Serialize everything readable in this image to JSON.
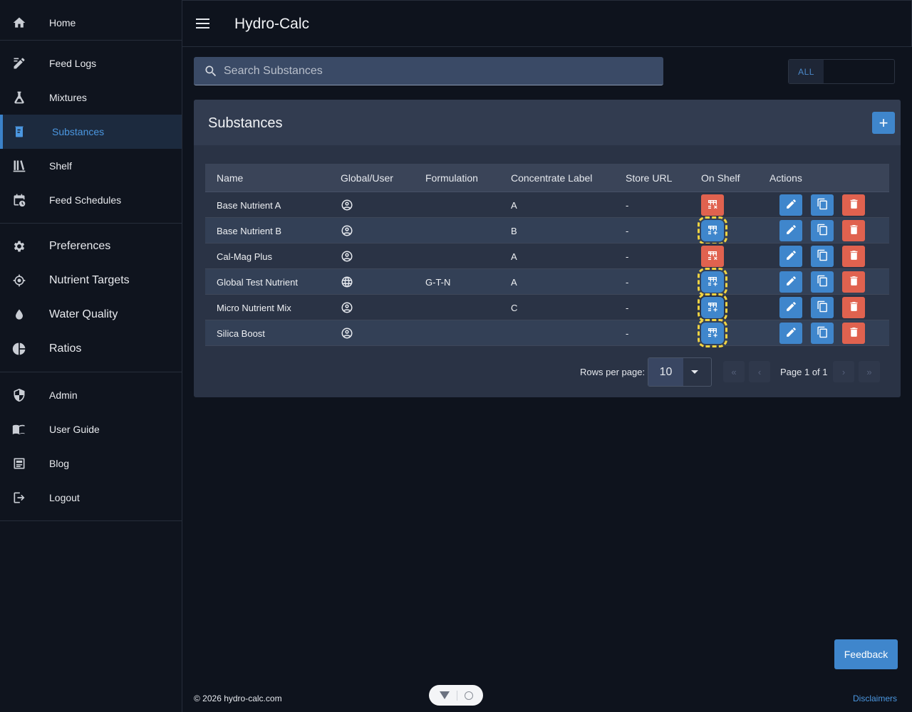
{
  "app": {
    "title": "Hydro-Calc"
  },
  "sidebar": {
    "groups": [
      [
        {
          "label": "Home",
          "icon": "home-icon"
        }
      ],
      [
        {
          "label": "Feed Logs",
          "icon": "feed-logs-icon"
        },
        {
          "label": "Mixtures",
          "icon": "flask-icon"
        },
        {
          "label": "Substances",
          "icon": "substance-icon",
          "active": true
        },
        {
          "label": "Shelf",
          "icon": "shelf-icon"
        },
        {
          "label": "Feed Schedules",
          "icon": "calendar-clock-icon"
        }
      ],
      [
        {
          "label": "Preferences",
          "icon": "gear-icon"
        },
        {
          "label": "Nutrient Targets",
          "icon": "crosshair-icon"
        },
        {
          "label": "Water Quality",
          "icon": "water-drop-icon"
        },
        {
          "label": "Ratios",
          "icon": "pie-chart-icon"
        }
      ],
      [
        {
          "label": "Admin",
          "icon": "shield-icon"
        },
        {
          "label": "User Guide",
          "icon": "book-icon"
        },
        {
          "label": "Blog",
          "icon": "newspaper-icon"
        },
        {
          "label": "Logout",
          "icon": "logout-icon"
        }
      ]
    ]
  },
  "search": {
    "placeholder": "Search Substances",
    "value": ""
  },
  "filter": {
    "all_label": "ALL"
  },
  "card": {
    "title": "Substances",
    "add_label": "+"
  },
  "table": {
    "headers": [
      "Name",
      "Global/User",
      "Formulation",
      "Concentrate Label",
      "Store URL",
      "On Shelf",
      "Actions"
    ],
    "rows": [
      {
        "name": "Base Nutrient A",
        "scope": "user",
        "formulation": "",
        "concentrate": "A",
        "url": "-",
        "on_shelf": false
      },
      {
        "name": "Base Nutrient B",
        "scope": "user",
        "formulation": "",
        "concentrate": "B",
        "url": "-",
        "on_shelf": true
      },
      {
        "name": "Cal-Mag Plus",
        "scope": "user",
        "formulation": "",
        "concentrate": "A",
        "url": "-",
        "on_shelf": false
      },
      {
        "name": "Global Test Nutrient",
        "scope": "global",
        "formulation": "G-T-N",
        "concentrate": "A",
        "url": "-",
        "on_shelf": true
      },
      {
        "name": "Micro Nutrient Mix",
        "scope": "user",
        "formulation": "",
        "concentrate": "C",
        "url": "-",
        "on_shelf": true
      },
      {
        "name": "Silica Boost",
        "scope": "user",
        "formulation": "",
        "concentrate": "",
        "url": "-",
        "on_shelf": true
      }
    ]
  },
  "pagination": {
    "rows_per_page_label": "Rows per page:",
    "rows_per_page": "10",
    "page_info": "Page 1 of 1",
    "first": "«",
    "prev": "‹",
    "next": "›",
    "last": "»"
  },
  "footer": {
    "feedback": "Feedback",
    "copyright": "© 2026 hydro-calc.com",
    "disclaimers": "Disclaimers"
  },
  "colors": {
    "accent": "#3f86cc",
    "danger": "#e0624f",
    "highlight": "#f2d442"
  }
}
